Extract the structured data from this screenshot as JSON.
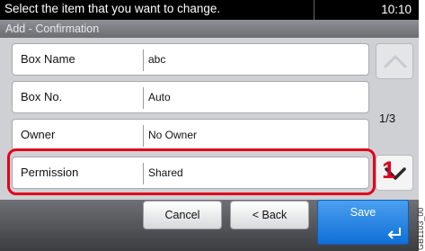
{
  "status": {
    "message": "Select the item that you want to change.",
    "time": "10:10"
  },
  "title": "Add - Confirmation",
  "rows": [
    {
      "label": "Box Name",
      "value": "abc"
    },
    {
      "label": "Box No.",
      "value": "Auto"
    },
    {
      "label": "Owner",
      "value": "No Owner"
    },
    {
      "label": "Permission",
      "value": "Shared"
    }
  ],
  "pager": {
    "indicator": "1/3"
  },
  "buttons": {
    "cancel": "Cancel",
    "back": "< Back",
    "save": "Save"
  },
  "callout_number": "1",
  "figure_code": "GB1103_00",
  "colors": {
    "highlight": "#e0001b",
    "save": "#1a7fe0"
  },
  "icons": {
    "scroll_up": "chevron-up-icon",
    "scroll_down": "chevron-down-icon",
    "enter": "enter-icon"
  }
}
